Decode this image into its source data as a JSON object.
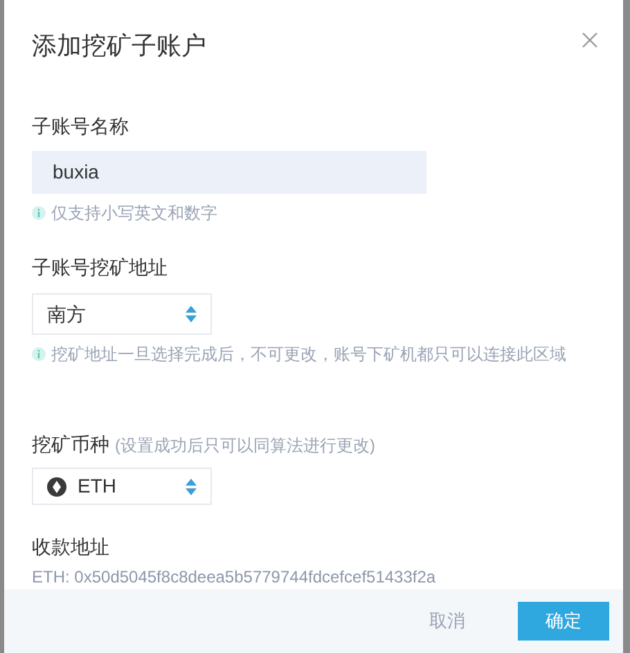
{
  "dialog": {
    "title": "添加挖矿子账户",
    "fields": [
      {
        "kind": "text",
        "label": "子账号名称",
        "value": "buxia",
        "hint": "仅支持小写英文和数字"
      },
      {
        "kind": "select",
        "label": "子账号挖矿地址",
        "value": "南方",
        "hint": "挖矿地址一旦选择完成后，不可更改，账号下矿机都只可以连接此区域"
      },
      {
        "kind": "coin",
        "label": "挖矿币种",
        "note": "(设置成功后只可以同算法进行更改)",
        "value": "ETH"
      },
      {
        "kind": "address",
        "label": "收款地址",
        "value": "ETH: 0x50d5045f8c8deea5b5779744fdcefcef51433f2a"
      }
    ],
    "buttons": [
      {
        "label": "取消",
        "kind": "cancel"
      },
      {
        "label": "确定",
        "kind": "primary"
      }
    ]
  }
}
